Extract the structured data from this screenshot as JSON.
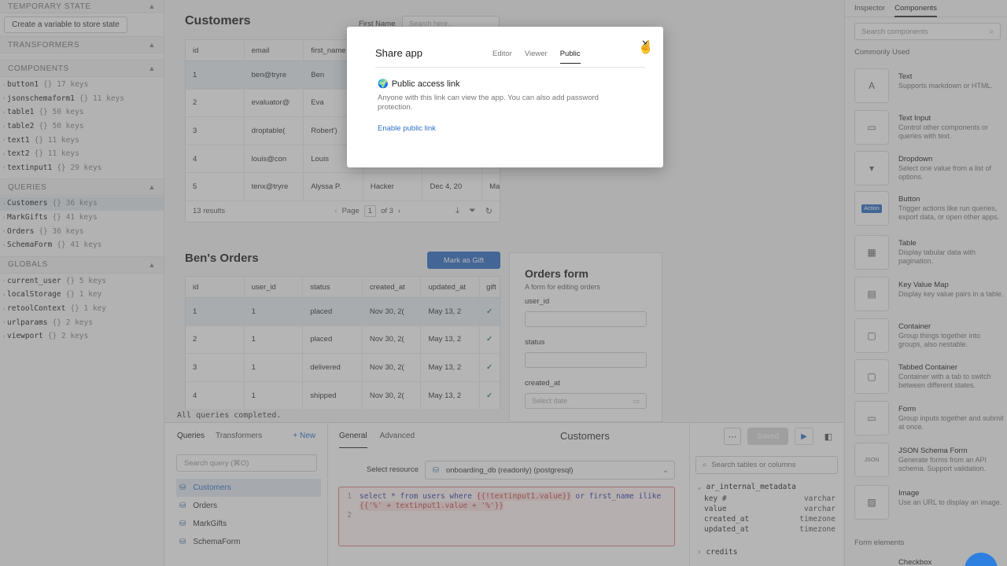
{
  "left": {
    "temporary_state": "TEMPORARY STATE",
    "create_var": "Create a variable to store state",
    "transformers": "TRANSFORMERS",
    "components": "COMPONENTS",
    "component_items": [
      {
        "name": "button1",
        "keys": "{}  17 keys"
      },
      {
        "name": "jsonschemaform1",
        "keys": "{}  11 keys"
      },
      {
        "name": "table1",
        "keys": "{}  50 keys"
      },
      {
        "name": "table2",
        "keys": "{}  50 keys"
      },
      {
        "name": "text1",
        "keys": "{}  11 keys"
      },
      {
        "name": "text2",
        "keys": "{}  11 keys"
      },
      {
        "name": "textinput1",
        "keys": "{}  29 keys"
      }
    ],
    "queries": "QUERIES",
    "query_items": [
      {
        "name": "Customers",
        "keys": "{}  36 keys"
      },
      {
        "name": "MarkGifts",
        "keys": "{}  41 keys"
      },
      {
        "name": "Orders",
        "keys": "{}  36 keys"
      },
      {
        "name": "SchemaForm",
        "keys": "{}  41 keys"
      }
    ],
    "globals": "GLOBALS",
    "global_items": [
      {
        "name": "current_user",
        "keys": "{}  5 keys"
      },
      {
        "name": "localStorage",
        "keys": "{}  1 key"
      },
      {
        "name": "retoolContext",
        "keys": "{}  1 key"
      },
      {
        "name": "urlparams",
        "keys": "{}  2 keys"
      },
      {
        "name": "viewport",
        "keys": "{}  2 keys"
      }
    ]
  },
  "canvas": {
    "customers_title": "Customers",
    "first_name_label": "First Name",
    "first_name_placeholder": "Search here...",
    "customers_headers": [
      "id",
      "email",
      "first_name"
    ],
    "customers_rows": [
      [
        "1",
        "ben@tryre",
        "Ben"
      ],
      [
        "2",
        "evaluator@",
        "Eva"
      ],
      [
        "3",
        "droptable(",
        "Robert')"
      ],
      [
        "4",
        "louis@con",
        "Louis"
      ],
      [
        "5",
        "tenx@tryre",
        "Alyssa P."
      ]
    ],
    "row5_extra": [
      "Hacker",
      "Dec 4, 20",
      "May"
    ],
    "results": "13 results",
    "page_label": "Page",
    "page_num": "1",
    "page_of": "of 3",
    "orders_title": "Ben's Orders",
    "mark_gift": "Mark as Gift",
    "orders_headers": [
      "id",
      "user_id",
      "status",
      "created_at",
      "updated_at",
      "gift"
    ],
    "orders_rows": [
      [
        "1",
        "1",
        "placed",
        "Nov 30, 2(",
        "May 13, 2"
      ],
      [
        "2",
        "1",
        "placed",
        "Nov 30, 2(",
        "May 13, 2"
      ],
      [
        "3",
        "1",
        "delivered",
        "Nov 30, 2(",
        "May 13, 2"
      ],
      [
        "4",
        "1",
        "shipped",
        "Nov 30, 2(",
        "May 13, 2"
      ]
    ],
    "form_title": "Orders form",
    "form_sub": "A form for editing orders",
    "form_user_id": "user_id",
    "form_status": "status",
    "form_created": "created_at",
    "form_date_ph": "Select date",
    "status_msg": "All queries completed."
  },
  "bottom": {
    "tab_queries": "Queries",
    "tab_transformers": "Transformers",
    "new": "+ New",
    "search_ph": "Search query (⌘O)",
    "queries": [
      "Customers",
      "Orders",
      "MarkGifts",
      "SchemaForm"
    ],
    "tab_general": "General",
    "tab_advanced": "Advanced",
    "query_title": "Customers",
    "saved": "Saved",
    "select_resource": "Select resource",
    "resource": "onboarding_db (readonly) (postgresql)",
    "line1_a": "select * from users where ",
    "line1_b": "{{!textinput1.value}}",
    "line1_c": " or first_name ilike",
    "line1_d": "{{'%' + textinput1.value + '%'}}",
    "schema_search": "Search tables or columns",
    "schema_table": "ar_internal_metadata",
    "schema_cols": [
      {
        "name": "key #",
        "type": "varchar"
      },
      {
        "name": "value",
        "type": "varchar"
      },
      {
        "name": "created_at",
        "type": "timezone"
      },
      {
        "name": "updated_at",
        "type": "timezone"
      }
    ],
    "schema_table2": "credits"
  },
  "right": {
    "tab_inspector": "Inspector",
    "tab_components": "Components",
    "search_ph": "Search components",
    "commonly_used": "Commonly Used",
    "items": [
      {
        "name": "Text",
        "desc": "Supports markdown or HTML.",
        "icon": "A"
      },
      {
        "name": "Text Input",
        "desc": "Control other components or queries with text.",
        "icon": "▭"
      },
      {
        "name": "Dropdown",
        "desc": "Select one value from a list of options.",
        "icon": "▾"
      },
      {
        "name": "Button",
        "desc": "Trigger actions like run queries, export data, or open other apps.",
        "icon": "Action"
      },
      {
        "name": "Table",
        "desc": "Display tabular data with pagination.",
        "icon": "▦"
      },
      {
        "name": "Key Value Map",
        "desc": "Display key value pairs in a table.",
        "icon": "▤"
      },
      {
        "name": "Container",
        "desc": "Group things together into groups, also nestable.",
        "icon": "▢"
      },
      {
        "name": "Tabbed Container",
        "desc": "Container with a tab to switch between different states.",
        "icon": "▢"
      },
      {
        "name": "Form",
        "desc": "Group inputs together and submit at once.",
        "icon": "▭"
      },
      {
        "name": "JSON Schema Form",
        "desc": "Generate forms from an API schema. Support validation.",
        "icon": "JSON"
      },
      {
        "name": "Image",
        "desc": "Use an URL to display an image.",
        "icon": "▨"
      }
    ],
    "form_elements": "Form elements",
    "checkbox": "Checkbox"
  },
  "modal": {
    "title": "Share app",
    "tabs": [
      "Editor",
      "Viewer",
      "Public"
    ],
    "heading": "Public access link",
    "desc": "Anyone with this link can view the app. You can also add password protection.",
    "link": "Enable public link"
  }
}
